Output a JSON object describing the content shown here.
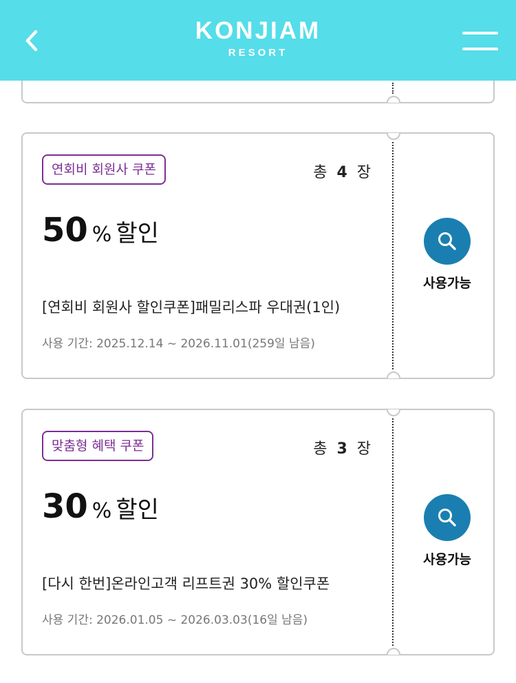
{
  "header": {
    "back_icon": "chevron-left-icon",
    "logo_main": "KONJIAM",
    "logo_sub": "RESORT",
    "menu_icon": "hamburger-menu-icon",
    "background_color": "#55dde9"
  },
  "coupons": [
    {
      "badge": "연회비 회원사 쿠폰",
      "count_prefix": "총",
      "count": "4",
      "count_suffix": "장",
      "discount_value": "50",
      "discount_unit": "%",
      "discount_text": "할인",
      "description": "[연회비 회원사 할인쿠폰]패밀리스파 우대권(1인)",
      "period": "사용 기간: 2025.12.14 ~ 2026.11.01(259일 남음)",
      "status": "사용가능"
    },
    {
      "badge": "맞춤형 혜택 쿠폰",
      "count_prefix": "총",
      "count": "3",
      "count_suffix": "장",
      "discount_value": "30",
      "discount_unit": "%",
      "discount_text": "할인",
      "description": "[다시 한번]온라인고객 리프트권 30% 할인쿠폰",
      "period": "사용 기간: 2026.01.05 ~ 2026.03.03(16일 남음)",
      "status": "사용가능"
    }
  ],
  "colors": {
    "badge": "#7b2e94",
    "action_button": "#1a7fb0",
    "border": "#c8c8c8"
  }
}
